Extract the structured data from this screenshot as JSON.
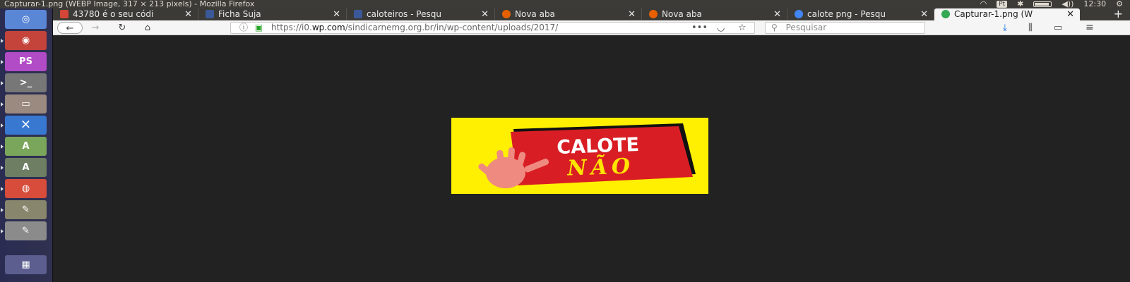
{
  "window_title": "Capturar-1.png (WEBP Image, 317 × 213 pixels) - Mozilla Firefox",
  "tray": {
    "keyboard": "Pt",
    "clock": "12:30"
  },
  "launcher": [
    {
      "name": "ubuntu-dash-icon",
      "color": "#5a86d6"
    },
    {
      "name": "chrome-icon",
      "color": "#c4433a"
    },
    {
      "name": "phpstorm-icon",
      "color": "#b24bc6"
    },
    {
      "name": "terminal-icon",
      "color": "#777777"
    },
    {
      "name": "files-icon",
      "color": "#9a8a7f"
    },
    {
      "name": "vscode-icon",
      "color": "#3978d0"
    },
    {
      "name": "android-studio-icon",
      "color": "#7aa65b"
    },
    {
      "name": "software-updater-icon",
      "color": "#6d7e63"
    },
    {
      "name": "firefox-icon",
      "color": "#d74c3a"
    },
    {
      "name": "gimp-icon",
      "color": "#88866c"
    },
    {
      "name": "text-editor-icon",
      "color": "#8b8b8b"
    },
    {
      "name": "trash-icon",
      "color": "#5b5e8e"
    }
  ],
  "tabs": [
    {
      "label": "43780 é o seu códi",
      "favicon_color": "#d44638"
    },
    {
      "label": "Ficha Suja",
      "favicon_color": "#3b5998"
    },
    {
      "label": "caloteiros - Pesqu",
      "favicon_color": "#3b5998"
    },
    {
      "label": "Nova aba",
      "favicon_color": "#e66000"
    },
    {
      "label": "Nova aba",
      "favicon_color": "#e66000"
    },
    {
      "label": "calote png - Pesqu",
      "favicon_color": "#4285f4"
    },
    {
      "label": "Capturar-1.png (W",
      "favicon_color": "#34a853"
    }
  ],
  "nav": {
    "url_prefix": "https://i0.",
    "url_domain": "wp.com",
    "url_rest": "/sindicarnemg.org.br/in/wp-content/uploads/2017/",
    "more": "•••",
    "search_placeholder": "Pesquisar"
  },
  "image": {
    "top_text": "CALOTE",
    "bottom_text": "NÃO",
    "bg_color": "#ffef00",
    "sign_color": "#d81e24",
    "hand_color": "#ef8a80"
  }
}
